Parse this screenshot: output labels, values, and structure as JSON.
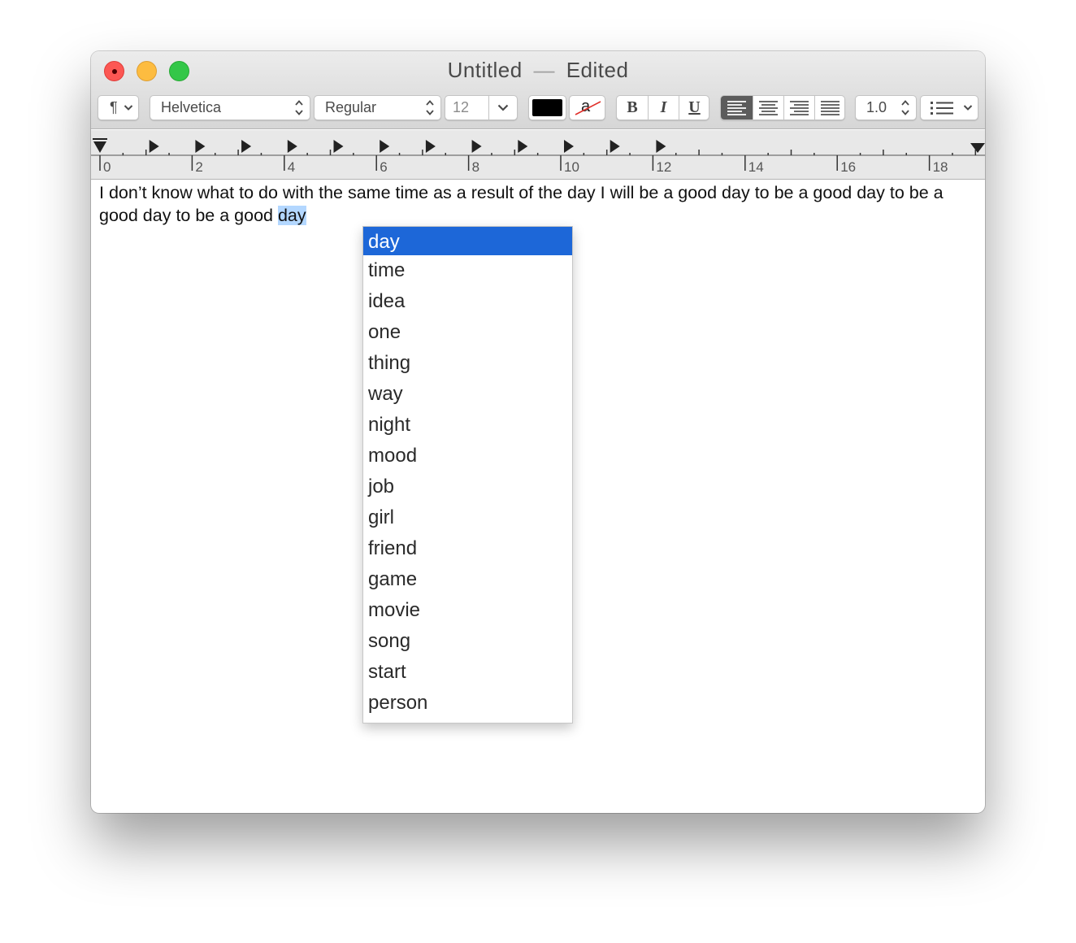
{
  "window": {
    "title": "Untitled",
    "separator": "—",
    "status": "Edited"
  },
  "toolbar": {
    "paragraph_symbol": "¶",
    "font_family": "Helvetica",
    "font_style": "Regular",
    "font_size": "12",
    "bold_label": "B",
    "italic_label": "I",
    "underline_label": "U",
    "highlight_label": "a",
    "line_spacing": "1.0",
    "text_color": "#000000"
  },
  "ruler": {
    "labels": [
      "0",
      "2",
      "4",
      "6",
      "8",
      "10",
      "12",
      "14",
      "16",
      "18"
    ]
  },
  "document": {
    "text_before": "I don’t know what to do with the same time as a result of the day I will be a good day to be a good day to be a good day to be a good ",
    "selected_word": "day"
  },
  "autocomplete": {
    "items": [
      "day",
      "time",
      "idea",
      "one",
      "thing",
      "way",
      "night",
      "mood",
      "job",
      "girl",
      "friend",
      "game",
      "movie",
      "song",
      "start",
      "person"
    ],
    "selected_index": 0,
    "selected_color": "#1d67d8"
  }
}
